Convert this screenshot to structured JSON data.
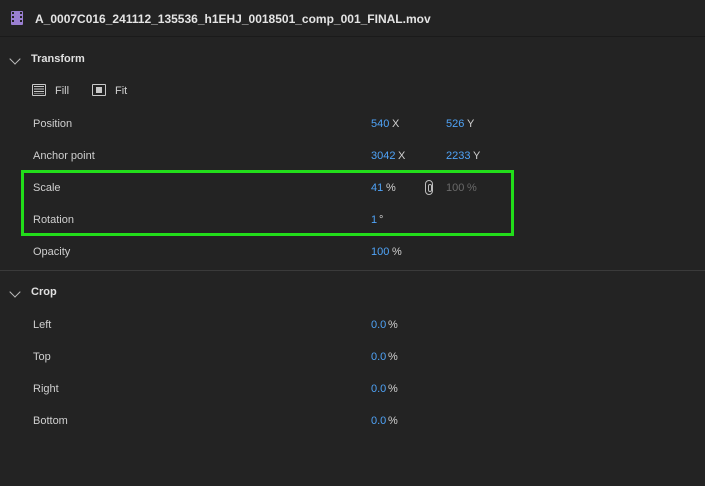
{
  "clip": {
    "icon": "clip-icon",
    "name": "A_0007C016_241112_135536_h1EHJ_0018501_comp_001_FINAL.mov"
  },
  "transform": {
    "title": "Transform",
    "fill_label": "Fill",
    "fit_label": "Fit",
    "position": {
      "label": "Position",
      "x": "540",
      "x_unit": "X",
      "y": "526",
      "y_unit": "Y"
    },
    "anchor": {
      "label": "Anchor point",
      "x": "3042",
      "x_unit": "X",
      "y": "2233",
      "y_unit": "Y"
    },
    "scale": {
      "label": "Scale",
      "value": "41",
      "unit": "%",
      "linked_value": "100",
      "linked_unit": "%"
    },
    "rotation": {
      "label": "Rotation",
      "value": "1",
      "unit": "°"
    },
    "opacity": {
      "label": "Opacity",
      "value": "100",
      "unit": "%"
    }
  },
  "crop": {
    "title": "Crop",
    "left": {
      "label": "Left",
      "value": "0.0",
      "unit": "%"
    },
    "top": {
      "label": "Top",
      "value": "0.0",
      "unit": "%"
    },
    "right": {
      "label": "Right",
      "value": "0.0",
      "unit": "%"
    },
    "bottom": {
      "label": "Bottom",
      "value": "0.0",
      "unit": "%"
    }
  },
  "colors": {
    "background": "#232323",
    "value_blue": "#4fa3f7",
    "highlight_green": "#22dd1a",
    "clip_icon_purple": "#9a7fd1"
  }
}
